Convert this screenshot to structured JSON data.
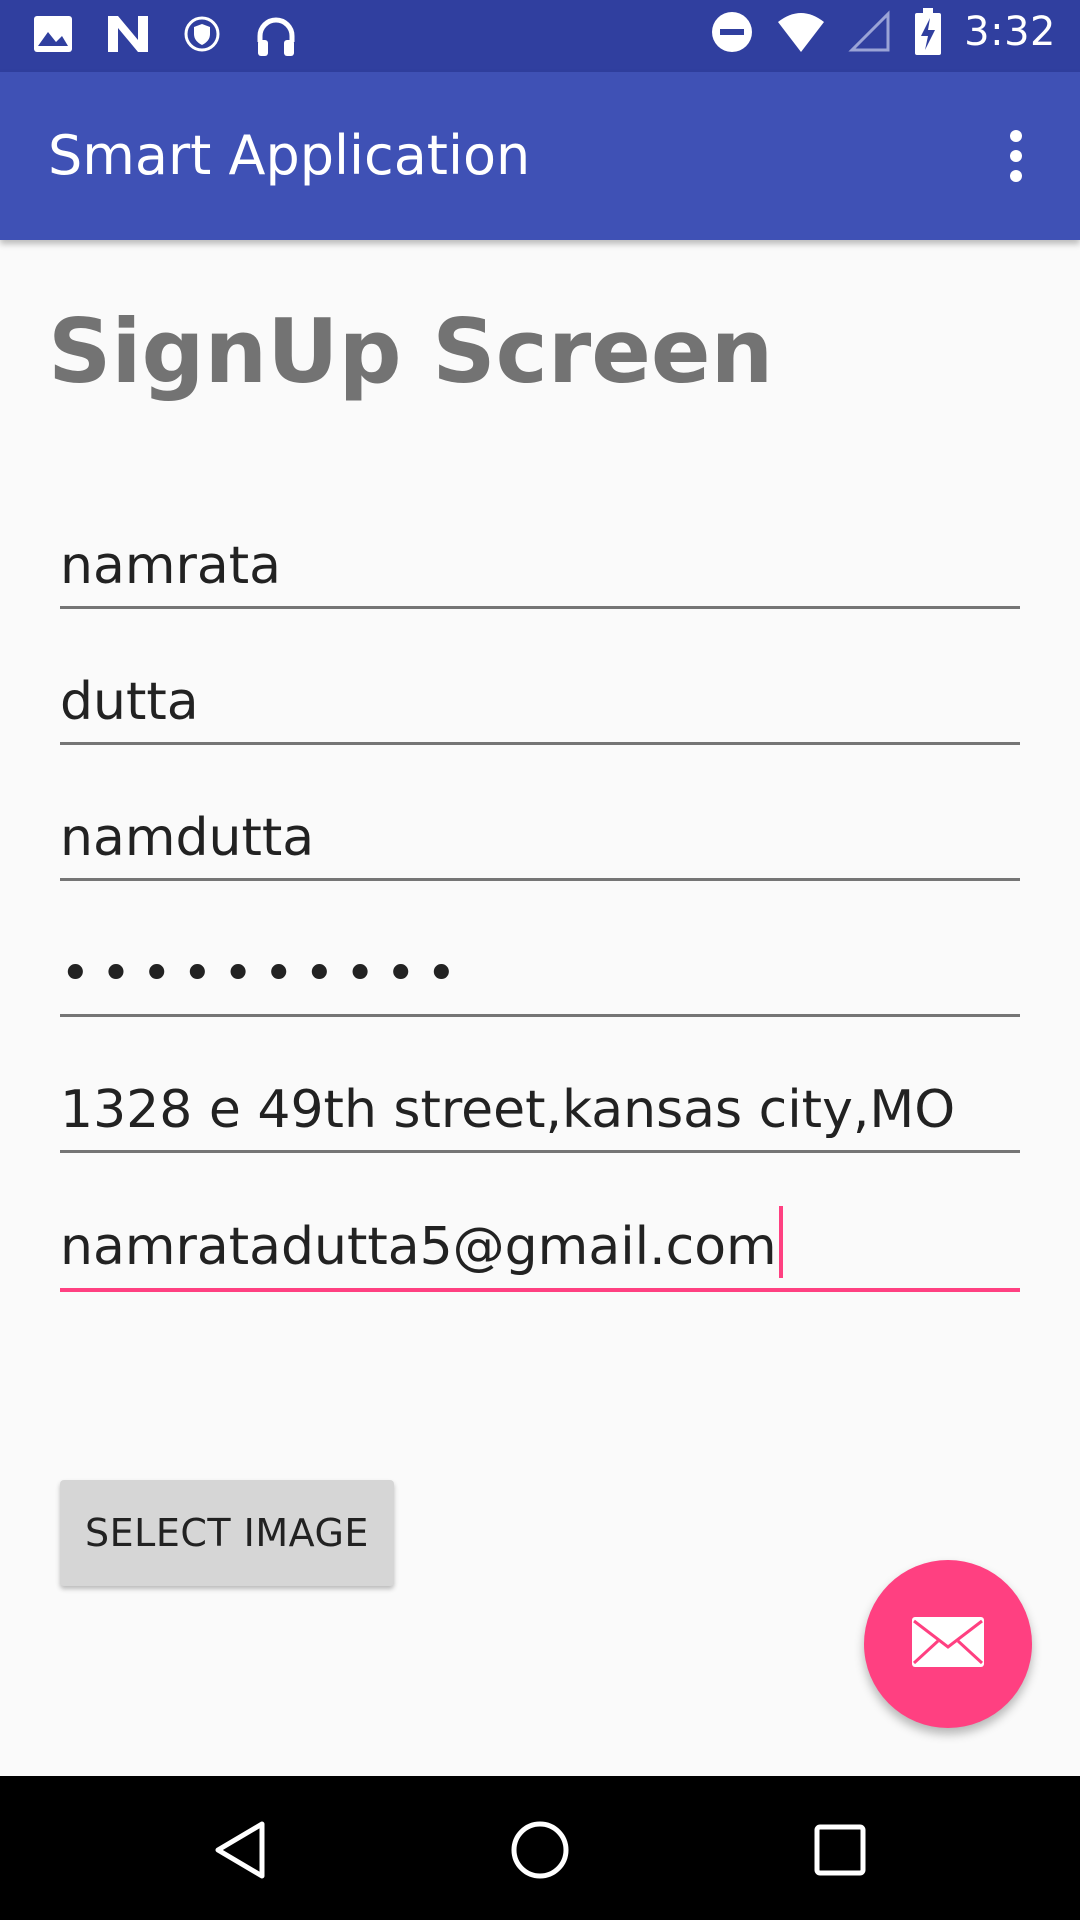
{
  "status_bar": {
    "time": "3:32",
    "icons": [
      "image-icon",
      "n-icon",
      "vpn-shield-icon",
      "headphones-icon",
      "do-not-disturb-icon",
      "wifi-icon",
      "signal-icon",
      "battery-charging-icon"
    ]
  },
  "app_bar": {
    "title": "Smart Application",
    "overflow_icon": "more-vert-icon"
  },
  "page": {
    "title": "SignUp Screen"
  },
  "form": {
    "first_name": "namrata",
    "last_name": "dutta",
    "username": "namdutta",
    "password_mask": "••••••••••",
    "address": "1328 e 49th street,kansas city,MO",
    "email": "namratadutta5@gmail.com"
  },
  "buttons": {
    "select_image": "SELECT IMAGE"
  },
  "fab": {
    "icon": "email-icon"
  },
  "nav_bar": {
    "icons": [
      "back-icon",
      "home-icon",
      "recents-icon"
    ]
  },
  "colors": {
    "status_bar": "#303f9f",
    "app_bar": "#3f51b5",
    "accent": "#ff4081"
  }
}
